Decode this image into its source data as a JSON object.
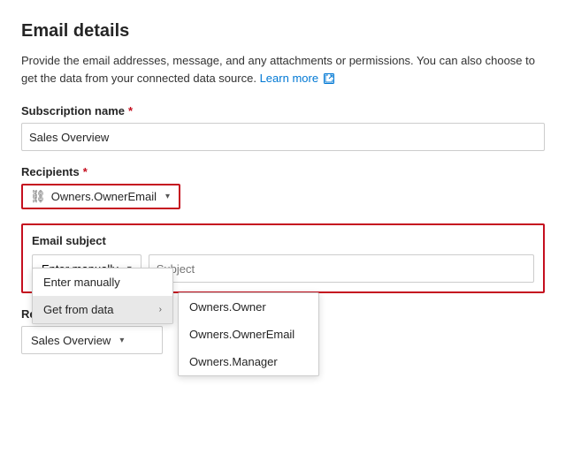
{
  "page": {
    "title": "Email details",
    "description": "Provide the email addresses, message, and any attachments or permissions. You can also choose to get the data from your connected data source.",
    "learn_more_label": "Learn more",
    "external_icon_label": "↗"
  },
  "subscription_name": {
    "label": "Subscription name",
    "required": true,
    "value": "Sales Overview"
  },
  "recipients": {
    "label": "Recipients",
    "required": true,
    "value": "Owners.OwnerEmail",
    "icon": "🔗"
  },
  "email_subject": {
    "label": "Email subject",
    "dropdown_value": "Enter manually",
    "placeholder": "Subject",
    "dropdown_items": [
      {
        "label": "Enter manually",
        "has_submenu": false
      },
      {
        "label": "Get from data",
        "has_submenu": true
      }
    ],
    "submenu_items": [
      {
        "label": "Owners.Owner"
      },
      {
        "label": "Owners.OwnerEmail"
      },
      {
        "label": "Owners.Manager"
      }
    ]
  },
  "report_page": {
    "label": "Report page",
    "has_info": true,
    "value": "Sales Overview"
  }
}
